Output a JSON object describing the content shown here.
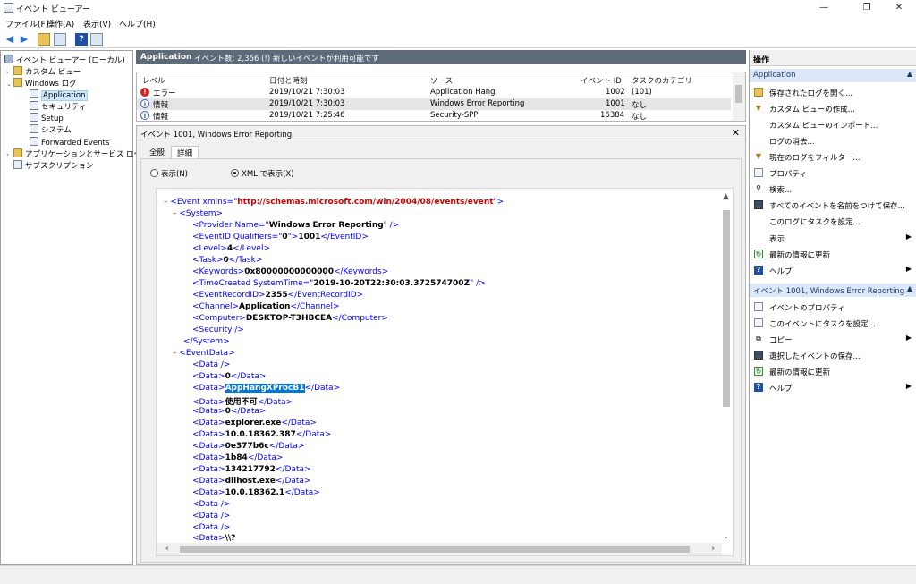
{
  "window": {
    "title": "イベント ビューアー",
    "controls": {
      "minimize": "—",
      "restore": "❐",
      "close": "✕"
    }
  },
  "menu": [
    "ファイル(F)",
    "操作(A)",
    "表示(V)",
    "ヘルプ(H)"
  ],
  "toolbar": {
    "back": "◀",
    "forward": "▶",
    "help": "?"
  },
  "tree": {
    "items": [
      {
        "label": "イベント ビューアー (ローカル)",
        "expander": "",
        "icon": "pc-icon",
        "selected": false
      },
      {
        "label": "カスタム ビュー",
        "expander": "›",
        "icon": "folder-icon",
        "selected": false
      },
      {
        "label": "Windows ログ",
        "expander": "⌄",
        "icon": "folder-icon",
        "selected": false
      },
      {
        "label": "Application",
        "expander": "",
        "icon": "log-icon",
        "selected": true
      },
      {
        "label": "セキュリティ",
        "expander": "",
        "icon": "log-icon",
        "selected": false
      },
      {
        "label": "Setup",
        "expander": "",
        "icon": "log-icon",
        "selected": false
      },
      {
        "label": "システム",
        "expander": "",
        "icon": "log-icon",
        "selected": false
      },
      {
        "label": "Forwarded Events",
        "expander": "",
        "icon": "log-icon",
        "selected": false
      },
      {
        "label": "アプリケーションとサービス ログ",
        "expander": "›",
        "icon": "folder-icon",
        "selected": false
      },
      {
        "label": "サブスクリプション",
        "expander": "",
        "icon": "log-icon",
        "selected": false
      }
    ]
  },
  "log_header": {
    "name": "Application",
    "summary": "イベント数: 2,356 (!) 新しいイベントが利用可能です"
  },
  "event_list": {
    "columns": [
      "レベル",
      "日付と時刻",
      "ソース",
      "イベント ID",
      "タスクのカテゴリ"
    ],
    "rows": [
      {
        "level": "エラー",
        "level_icon": "error-icon",
        "datetime": "2019/10/21 7:30:03",
        "source": "Application Hang",
        "event_id": "1002",
        "category": "(101)"
      },
      {
        "level": "情報",
        "level_icon": "info-icon",
        "datetime": "2019/10/21 7:30:03",
        "source": "Windows Error Reporting",
        "event_id": "1001",
        "category": "なし"
      },
      {
        "level": "情報",
        "level_icon": "info-icon",
        "datetime": "2019/10/21 7:25:46",
        "source": "Security-SPP",
        "event_id": "16384",
        "category": "なし"
      }
    ]
  },
  "detail": {
    "title": "イベント 1001, Windows Error Reporting",
    "close": "✕",
    "tabs": [
      "全般",
      "詳細"
    ],
    "radio_friendly": "表示(N)",
    "radio_xml": "XML で表示(X)"
  },
  "xml": {
    "minus": "–",
    "event_open": "<Event xmlns=\"",
    "event_ns": "http://schemas.microsoft.com/win/2004/08/events/event",
    "system_open": "<System>",
    "provider_pre": "<Provider Name=\"",
    "provider_val": "Windows Error Reporting",
    "provider_post": "\" />",
    "eventid_pre": "<EventID Qualifiers=\"",
    "eventid_q": "0",
    "eventid_mid": "\">",
    "eventid_val": "1001",
    "eventid_close": "</EventID>",
    "level_open": "<Level>",
    "level_val": "4",
    "level_close": "</Level>",
    "task_open": "<Task>",
    "task_val": "0",
    "task_close": "</Task>",
    "kw_open": "<Keywords>",
    "kw_val": "0x80000000000000",
    "kw_close": "</Keywords>",
    "tc_pre": "<TimeCreated SystemTime=\"",
    "tc_val": "2019-10-20T22:30:03.372574700Z",
    "tc_post": "\" />",
    "erid_open": "<EventRecordID>",
    "erid_val": "2355",
    "erid_close": "</EventRecordID>",
    "ch_open": "<Channel>",
    "ch_val": "Application",
    "ch_close": "</Channel>",
    "comp_open": "<Computer>",
    "comp_val": "DESKTOP-T3HBCEA",
    "comp_close": "</Computer>",
    "security": "<Security />",
    "system_close": "</System>",
    "eventdata_open": "<EventData>",
    "data_open": "<Data>",
    "data_close": "</Data>",
    "data_empty": "<Data />",
    "data_values": [
      "0",
      "AppHangXProcB1",
      "使用不可",
      "0",
      "explorer.exe",
      "10.0.18362.387",
      "0e377b6c",
      "1b84",
      "134217792",
      "dllhost.exe",
      "10.0.18362.1"
    ],
    "data_last": "\\\\?"
  },
  "actions": {
    "title": "操作",
    "section1": "Application",
    "section1_items": [
      {
        "label": "保存されたログを開く...",
        "icon": "folder-open-icon",
        "arrow": ""
      },
      {
        "label": "カスタム ビューの作成...",
        "icon": "filter-icon",
        "arrow": ""
      },
      {
        "label": "カスタム ビューのインポート...",
        "icon": "none",
        "arrow": ""
      },
      {
        "label": "ログの消去...",
        "icon": "none",
        "arrow": ""
      },
      {
        "label": "現在のログをフィルター...",
        "icon": "filter-icon",
        "arrow": ""
      },
      {
        "label": "プロパティ",
        "icon": "properties-icon",
        "arrow": ""
      },
      {
        "label": "検索...",
        "icon": "find-icon",
        "arrow": ""
      },
      {
        "label": "すべてのイベントを名前をつけて保存...",
        "icon": "save-icon",
        "arrow": ""
      },
      {
        "label": "このログにタスクを設定...",
        "icon": "none",
        "arrow": ""
      },
      {
        "label": "表示",
        "icon": "none",
        "arrow": "▶"
      },
      {
        "label": "最新の情報に更新",
        "icon": "refresh-icon",
        "arrow": ""
      },
      {
        "label": "ヘルプ",
        "icon": "help-icon",
        "arrow": "▶"
      }
    ],
    "section2": "イベント 1001, Windows Error Reporting",
    "section2_items": [
      {
        "label": "イベントのプロパティ",
        "icon": "properties-icon",
        "arrow": ""
      },
      {
        "label": "このイベントにタスクを設定...",
        "icon": "task-icon",
        "arrow": ""
      },
      {
        "label": "コピー",
        "icon": "copy-icon",
        "arrow": "▶"
      },
      {
        "label": "選択したイベントの保存...",
        "icon": "save-icon",
        "arrow": ""
      },
      {
        "label": "最新の情報に更新",
        "icon": "refresh-icon",
        "arrow": ""
      },
      {
        "label": "ヘルプ",
        "icon": "help-icon",
        "arrow": "▶"
      }
    ]
  }
}
